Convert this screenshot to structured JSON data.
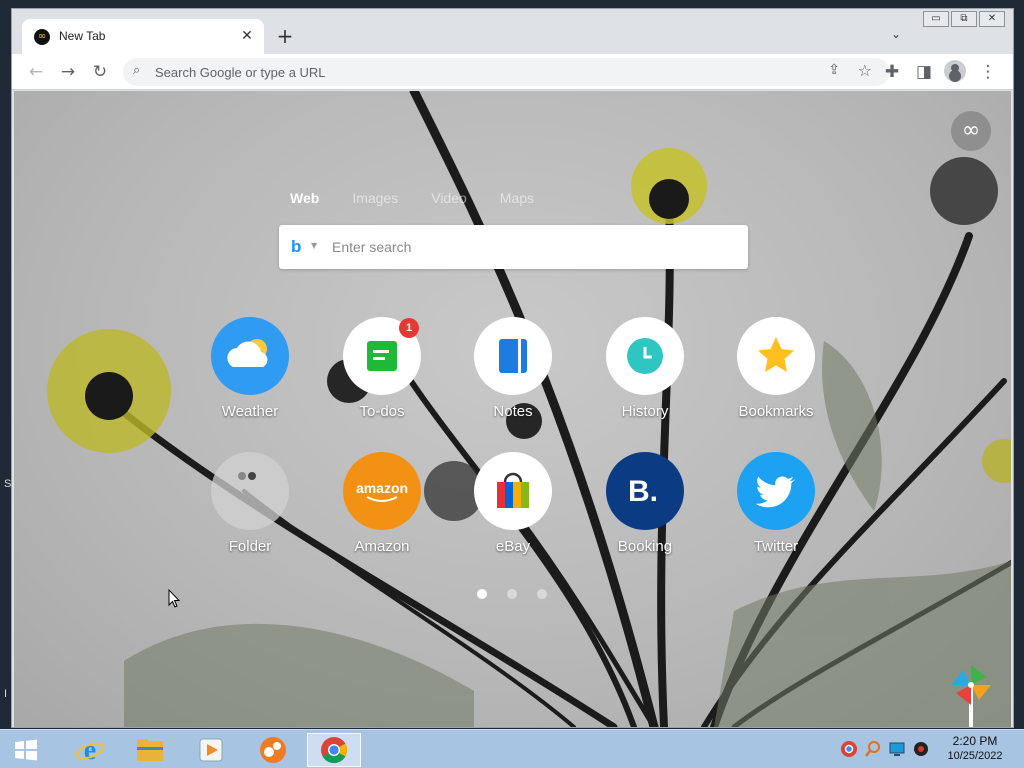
{
  "desktop": {
    "frag_s": "S",
    "frag_i": "I"
  },
  "window": {
    "controls": {
      "minimize": "▭",
      "restore": "⧉",
      "close": "✕"
    }
  },
  "tab": {
    "title": "New Tab",
    "close": "✕"
  },
  "tabstrip": {
    "new_tab": "+",
    "tab_search": "⌄"
  },
  "toolbar": {
    "back": "←",
    "forward": "→",
    "reload": "↻",
    "omnibox_placeholder": "Search Google or type a URL",
    "share": "⇪",
    "bookmark": "☆",
    "extensions": "✚",
    "side_panel": "◨",
    "menu": "⋮"
  },
  "ntp": {
    "infinity": "∞",
    "search_tabs": [
      "Web",
      "Images",
      "Video",
      "Maps"
    ],
    "engine_logo": "b",
    "engine_caret": "▼",
    "search_placeholder": "Enter search",
    "shortcuts": [
      {
        "label": "Weather",
        "icon": "weather-icon",
        "bg": "#2f9bf2"
      },
      {
        "label": "To-dos",
        "icon": "todo-icon",
        "bg": "#ffffff",
        "badge": "1"
      },
      {
        "label": "Notes",
        "icon": "notes-icon",
        "bg": "#ffffff"
      },
      {
        "label": "History",
        "icon": "clock-icon",
        "bg": "#ffffff"
      },
      {
        "label": "Bookmarks",
        "icon": "star-icon",
        "bg": "#ffffff"
      },
      {
        "label": "Folder",
        "icon": "folder-icon",
        "bg": "#c8c8c8"
      },
      {
        "label": "Amazon",
        "icon": "amazon-icon",
        "bg": "#f39115",
        "logo": "amazon"
      },
      {
        "label": "eBay",
        "icon": "ebay-bag-icon",
        "bg": "#ffffff"
      },
      {
        "label": "Booking",
        "icon": "booking-icon",
        "bg": "#0b3b82",
        "logo": "B."
      },
      {
        "label": "Twitter",
        "icon": "twitter-bird-icon",
        "bg": "#1da1f2"
      }
    ],
    "pager": {
      "pages": 3,
      "active": 0
    }
  },
  "taskbar": {
    "apps": [
      "windows-start-icon",
      "internet-explorer-icon",
      "file-explorer-icon",
      "media-player-icon",
      "app-icon",
      "chrome-icon"
    ],
    "clock": {
      "time": "2:20 PM",
      "date": "10/25/2022"
    }
  },
  "colors": {
    "accent": "#1a73e8",
    "taskbar": "#a7c4e3",
    "badge": "#e53935"
  }
}
